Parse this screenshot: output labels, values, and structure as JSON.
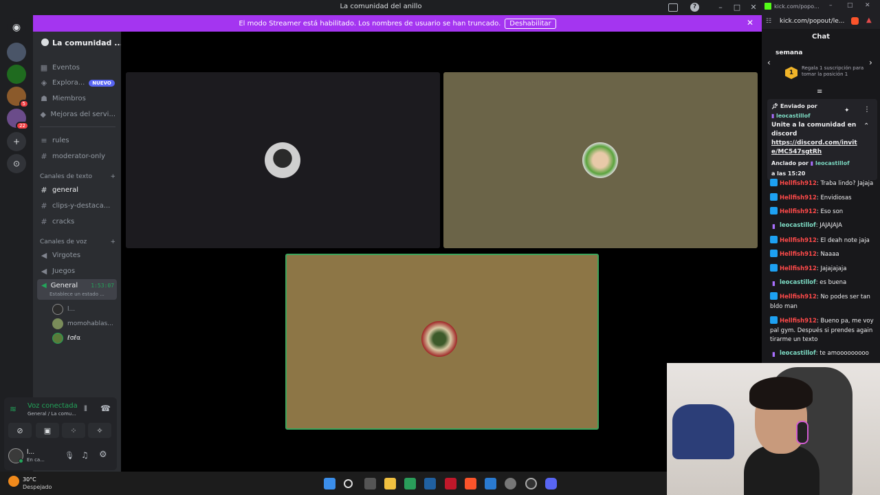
{
  "window": {
    "title": "La comunidad del anillo"
  },
  "banner": {
    "text": "El modo Streamer está habilitado. Los nombres de usuario se han truncado.",
    "button": "Deshabilitar"
  },
  "rail": {
    "badges": [
      "5",
      "22"
    ]
  },
  "server": {
    "name": "La comunidad ...",
    "top_items": [
      {
        "label": "Eventos",
        "icon": "calendar-icon"
      },
      {
        "label": "Explora...",
        "icon": "compass-icon",
        "pill": "NUEVO"
      },
      {
        "label": "Miembros",
        "icon": "members-icon"
      },
      {
        "label": "Mejoras del servi...",
        "icon": "boost-icon"
      }
    ],
    "channels_top": [
      "rules",
      "moderator-only"
    ],
    "text_category": "Canales de texto",
    "text_channels": [
      "general",
      "clips-y-destaca...",
      "cracks"
    ],
    "voice_category": "Canales de voz",
    "voice_channels": [
      "Virgotes",
      "Juegos"
    ],
    "voice_active": {
      "name": "General",
      "timer": "1:53:07",
      "status": "Establece un estado ..."
    },
    "voice_users": [
      "l...",
      "momohablas...",
      "ℓσℓα"
    ]
  },
  "voice_panel": {
    "status": "Voz conectada",
    "location": "General / La comu...",
    "user": "l...",
    "user_status": "En ca..."
  },
  "chat": {
    "url": "kick.com/popout/le...",
    "tab_url": "kick.com/popo...",
    "title": "Chat",
    "week_label": "semana",
    "sub_rank": "1",
    "sub_promo": "Regala 1 suscripción para tomar la posición 1",
    "pinned": {
      "sent_by": "Enviado por",
      "author": "leocastillof",
      "text": "Unite a la comunidad en discord",
      "link": "https://discord.com/invite/MC547sgtRh",
      "pinned_by_label": "Anclado por",
      "pinned_by": "leocastillof",
      "time": "a las 15:20"
    },
    "messages": [
      {
        "user": "Hellfish912",
        "text": ": Traba lindo? Jajaja",
        "role": "sub"
      },
      {
        "user": "Hellfish912",
        "text": ": Envidiosas",
        "role": "sub"
      },
      {
        "user": "Hellfish912",
        "text": ": Eso son",
        "role": "sub"
      },
      {
        "user": "leocastillof",
        "text": ": JAJAJAJA",
        "role": "host"
      },
      {
        "user": "Hellfish912",
        "text": ": El deah note jaja",
        "role": "sub"
      },
      {
        "user": "Hellfish912",
        "text": ": Naaaa",
        "role": "sub"
      },
      {
        "user": "Hellfish912",
        "text": ": Jajajajaja",
        "role": "sub"
      },
      {
        "user": "leocastillof",
        "text": ": es buena",
        "role": "host"
      },
      {
        "user": "Hellfish912",
        "text": ": No podes ser tan bldo man",
        "role": "sub"
      },
      {
        "user": "Hellfish912",
        "text": ": Bueno pa, me voy pal gym. Después si prendes again tirarme un texto",
        "role": "sub"
      },
      {
        "user": "leocastillof",
        "text": ": te amooooooooo",
        "role": "host"
      }
    ]
  },
  "weather": {
    "temp": "30°C",
    "desc": "Despejado"
  },
  "colors": {
    "accent": "#a435f0",
    "discord_bg": "#2b2d31",
    "voice_green": "#23a55a",
    "kick_green": "#53fc18"
  }
}
